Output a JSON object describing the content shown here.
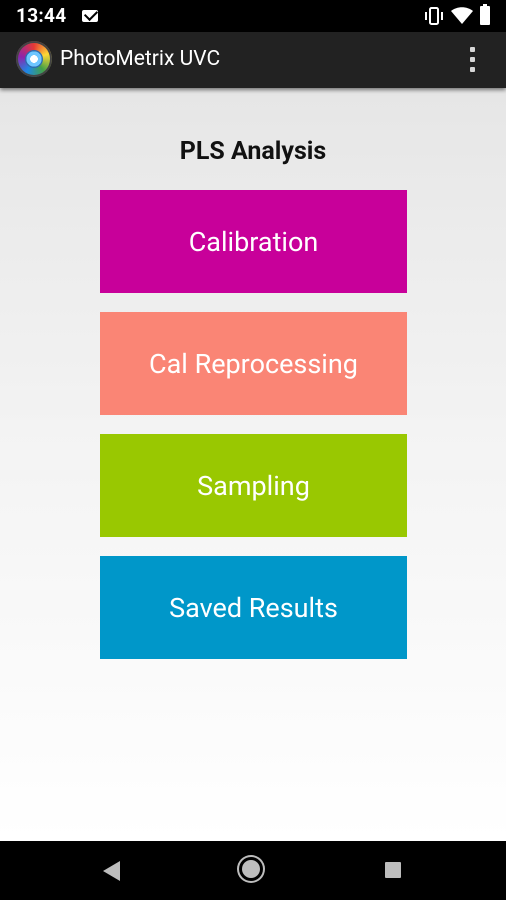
{
  "status_bar": {
    "time": "13:44"
  },
  "app_bar": {
    "title": "PhotoMetrix UVC"
  },
  "page": {
    "title": "PLS Analysis"
  },
  "buttons": [
    {
      "label": "Calibration",
      "color": "#c8009a"
    },
    {
      "label": "Cal Reprocessing",
      "color": "#fa8575"
    },
    {
      "label": "Sampling",
      "color": "#99c801"
    },
    {
      "label": "Saved Results",
      "color": "#0097c9"
    }
  ],
  "colors": {
    "status_bar_bg": "#000000",
    "app_bar_bg": "#222222",
    "nav_bar_bg": "#000000"
  },
  "icons": {
    "status": [
      "mail-icon",
      "vibrate-icon",
      "wifi-icon",
      "battery-icon"
    ],
    "app_bar": [
      "app-logo-icon",
      "overflow-menu-icon"
    ],
    "nav": [
      "back-icon",
      "home-icon",
      "recents-icon"
    ]
  }
}
